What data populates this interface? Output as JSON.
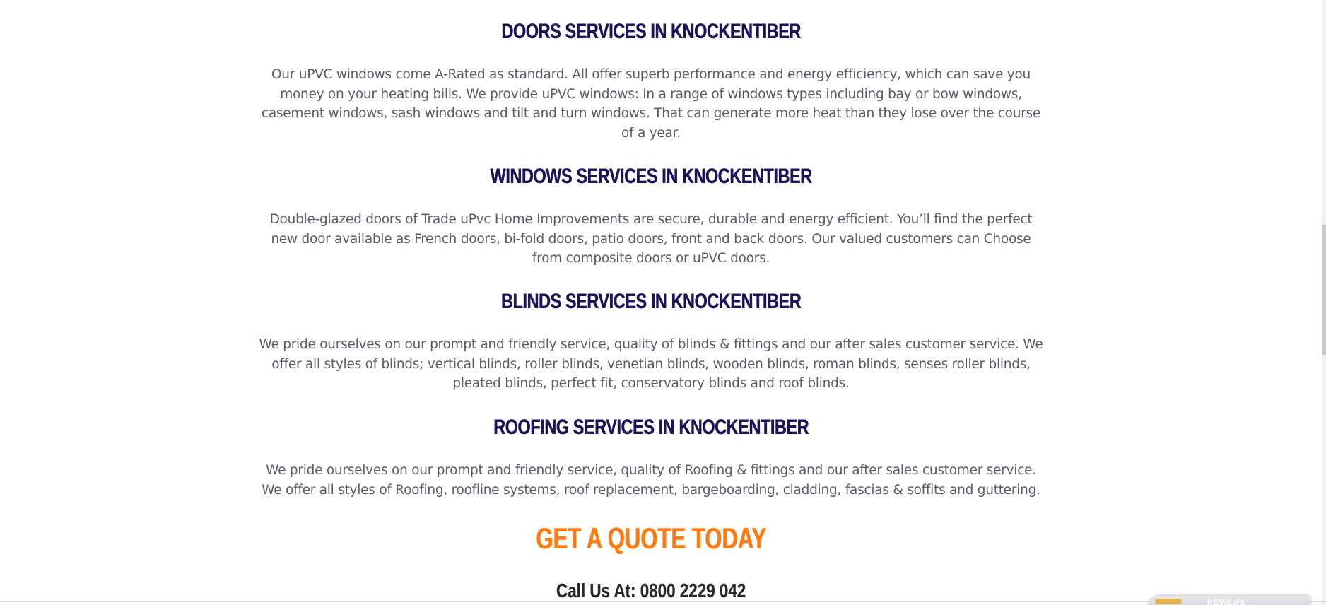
{
  "sections": [
    {
      "heading": "DOORS SERVICES IN KNOCKENTIBER",
      "text": "Our uPVC windows come A-Rated as standard. All offer superb performance and energy efficiency, which can save you money on your heating bills. We provide uPVC windows: In a range of windows types including bay or bow windows, casement windows, sash windows and tilt and turn windows. That can generate more heat than they lose over the course of a year."
    },
    {
      "heading": "WINDOWS SERVICES IN KNOCKENTIBER",
      "text": "Double-glazed doors of Trade uPvc Home Improvements are secure, durable and energy efficient. You’ll find the perfect new door available as French doors, bi-fold doors, patio doors, front and back doors. Our valued customers can Choose from composite doors or uPVC doors."
    },
    {
      "heading": "BLINDS SERVICES IN KNOCKENTIBER",
      "text": "We pride ourselves on our prompt and friendly service, quality of blinds & fittings and our after sales customer service. We offer all styles of blinds; vertical blinds, roller blinds, venetian blinds, wooden blinds, roman blinds, senses roller blinds, pleated blinds, perfect fit, conservatory blinds and roof blinds."
    },
    {
      "heading": "ROOFING SERVICES IN KNOCKENTIBER",
      "text": "We pride ourselves on our prompt and friendly service, quality of Roofing & fittings and our after sales customer service. We offer all styles of Roofing, roofline systems, roof replacement, bargeboarding, cladding, fascias & soffits and guttering."
    }
  ],
  "cta": {
    "heading": "GET A QUOTE TODAY",
    "call_prefix": "Call Us At:",
    "phone": "0800 2229 042"
  },
  "widget": {
    "text": "REVIEWS"
  },
  "colors": {
    "heading": "#1c1458",
    "body_text": "#5b5b6b",
    "cta": "#ff7a12"
  }
}
